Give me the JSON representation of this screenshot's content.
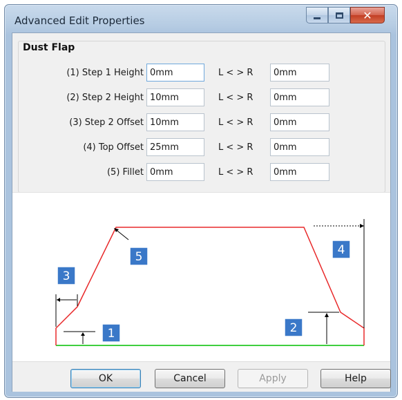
{
  "window": {
    "title": "Advanced Edit Properties"
  },
  "group": {
    "label": "Dust Flap"
  },
  "fields": [
    {
      "label": "(1) Step 1 Height",
      "value": "0mm",
      "separator": "L < > R",
      "right_value": "0mm"
    },
    {
      "label": "(2) Step 2 Height",
      "value": "10mm",
      "separator": "L < > R",
      "right_value": "0mm"
    },
    {
      "label": "(3) Step 2 Offset",
      "value": "10mm",
      "separator": "L < > R",
      "right_value": "0mm"
    },
    {
      "label": "(4) Top Offset",
      "value": "25mm",
      "separator": "L < > R",
      "right_value": "0mm"
    },
    {
      "label": "(5) Fillet",
      "value": "0mm",
      "separator": "L < > R",
      "right_value": "0mm"
    }
  ],
  "diagram": {
    "badges": [
      "1",
      "2",
      "3",
      "4",
      "5"
    ],
    "colors": {
      "profile": "#e8292a",
      "base": "#3fcf3f",
      "badge": "#3a78c8"
    }
  },
  "buttons": {
    "ok": "OK",
    "cancel": "Cancel",
    "apply": "Apply",
    "help": "Help"
  }
}
